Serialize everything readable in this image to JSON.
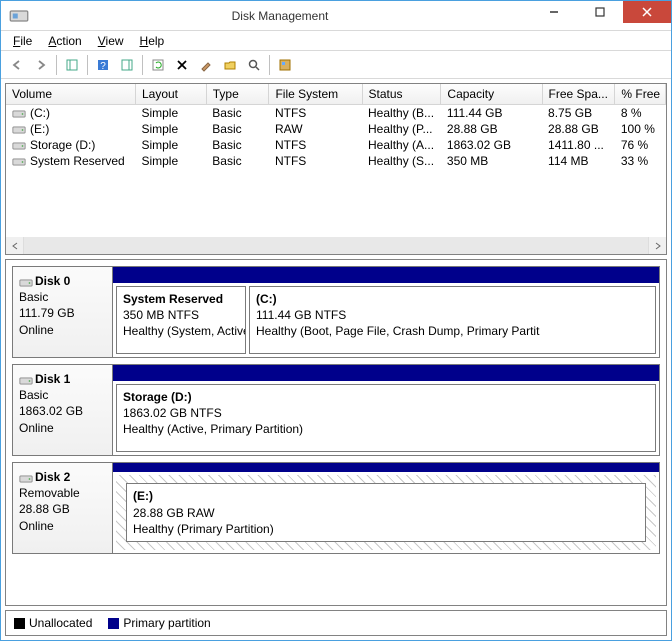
{
  "title": "Disk Management",
  "menu": {
    "file": "File",
    "action": "Action",
    "view": "View",
    "help": "Help"
  },
  "columns": {
    "volume": "Volume",
    "layout": "Layout",
    "type": "Type",
    "fs": "File System",
    "status": "Status",
    "capacity": "Capacity",
    "free": "Free Spa...",
    "pctfree": "% Free"
  },
  "volumes": [
    {
      "name": "(C:)",
      "layout": "Simple",
      "type": "Basic",
      "fs": "NTFS",
      "status": "Healthy (B...",
      "capacity": "111.44 GB",
      "free": "8.75 GB",
      "pct": "8 %"
    },
    {
      "name": "(E:)",
      "layout": "Simple",
      "type": "Basic",
      "fs": "RAW",
      "status": "Healthy (P...",
      "capacity": "28.88 GB",
      "free": "28.88 GB",
      "pct": "100 %"
    },
    {
      "name": "Storage (D:)",
      "layout": "Simple",
      "type": "Basic",
      "fs": "NTFS",
      "status": "Healthy (A...",
      "capacity": "1863.02 GB",
      "free": "1411.80 ...",
      "pct": "76 %"
    },
    {
      "name": "System Reserved",
      "layout": "Simple",
      "type": "Basic",
      "fs": "NTFS",
      "status": "Healthy (S...",
      "capacity": "350 MB",
      "free": "114 MB",
      "pct": "33 %"
    }
  ],
  "disks": [
    {
      "name": "Disk 0",
      "kind": "Basic",
      "size": "111.79 GB",
      "state": "Online",
      "parts": [
        {
          "title": "System Reserved",
          "size": "350 MB NTFS",
          "status": "Healthy (System, Active,",
          "w": 130,
          "hatched": false
        },
        {
          "title": "(C:)",
          "size": "111.44 GB NTFS",
          "status": "Healthy (Boot, Page File, Crash Dump, Primary Partit",
          "w": 0,
          "hatched": false
        }
      ]
    },
    {
      "name": "Disk 1",
      "kind": "Basic",
      "size": "1863.02 GB",
      "state": "Online",
      "parts": [
        {
          "title": "Storage (D:)",
          "size": "1863.02 GB NTFS",
          "status": "Healthy (Active, Primary Partition)",
          "w": 0,
          "hatched": false
        }
      ]
    },
    {
      "name": "Disk 2",
      "kind": "Removable",
      "size": "28.88 GB",
      "state": "Online",
      "parts": [
        {
          "title": "(E:)",
          "size": "28.88 GB RAW",
          "status": "Healthy (Primary Partition)",
          "w": 0,
          "hatched": true
        }
      ]
    }
  ],
  "legend": {
    "unallocated": "Unallocated",
    "primary": "Primary partition"
  }
}
